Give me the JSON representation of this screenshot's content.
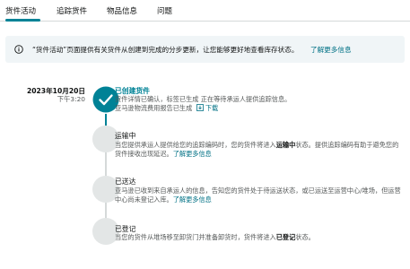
{
  "tabs": [
    {
      "label": "货件活动",
      "active": true
    },
    {
      "label": "追踪货件",
      "active": false
    },
    {
      "label": "物品信息",
      "active": false
    },
    {
      "label": "问题",
      "active": false
    }
  ],
  "banner": {
    "text": "“货件活动”页面提供有关货件从创建到完成的分步更新，让您能够更好地查看库存状态。",
    "link": "了解更多信息"
  },
  "timeline": {
    "date": "2023年10月20日",
    "time": "下午3:20",
    "steps": [
      {
        "title": "已创建货件",
        "status": "done",
        "desc1": "货件详情已确认，标签已生成 正在等待承运人提供追踪信息。",
        "desc2": "亚马逊物流费用报告已生成",
        "download": "下载"
      },
      {
        "title": "运输中",
        "status": "pending",
        "desc1_a": "当您提供承运人提供给您的追踪编码时，您的货件将进入",
        "desc1_b": "运输中",
        "desc1_c": "状态。提供追踪编码有助于避免您的",
        "desc2": "货件接收出现延迟。",
        "link": "了解更多信息"
      },
      {
        "title": "已送达",
        "status": "pending",
        "desc1": "亚马逊已收到来自承运人的信息，告知您的货件处于待运送状态，或已运送至运营中心/堆场，但运营",
        "desc2": "中心尚未登记入库。",
        "link": "了解更多信息"
      },
      {
        "title": "已登记",
        "status": "pending",
        "desc1_a": "当您的货件从堆场移至卸货门并准备卸货时，货件将进入",
        "desc1_b": "已登记",
        "desc1_c": "状态。"
      }
    ]
  },
  "colors": {
    "accent": "#008296",
    "link": "#007185",
    "banner_bg": "#f0f5f7",
    "pending_dot": "#e3e6e6"
  }
}
